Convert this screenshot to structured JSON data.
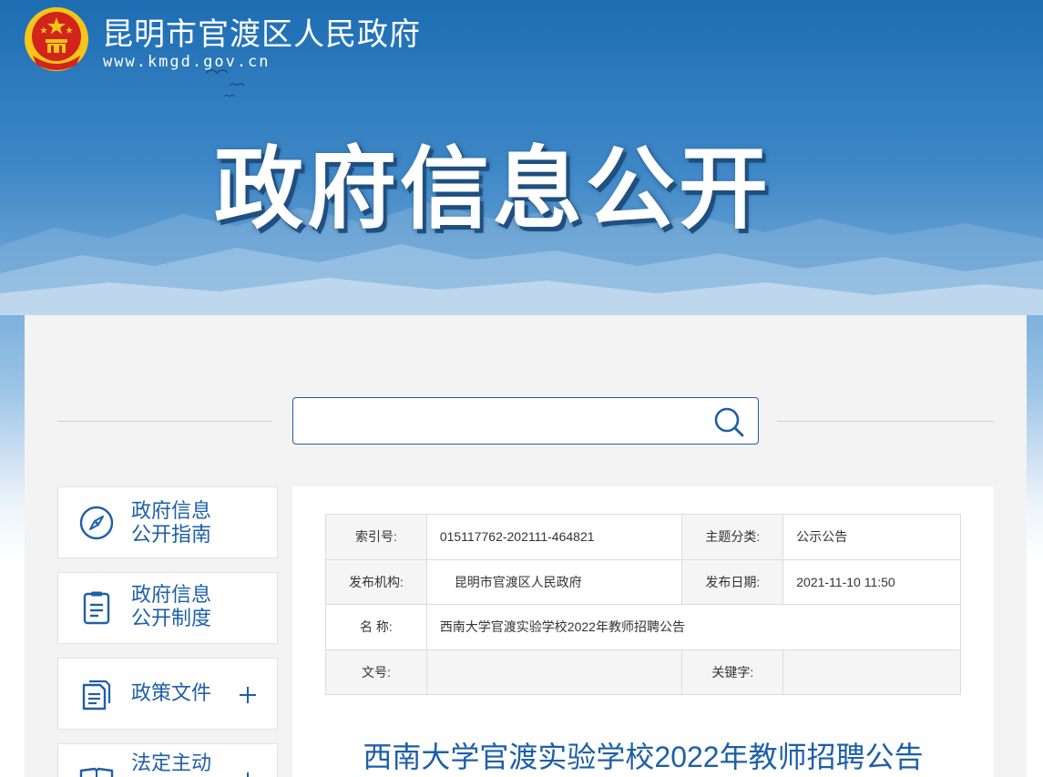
{
  "header": {
    "site_name": "昆明市官渡区人民政府",
    "site_url": "www.kmgd.gov.cn",
    "banner_title": "政府信息公开"
  },
  "search": {
    "value": "",
    "placeholder": ""
  },
  "sidebar": {
    "items": [
      {
        "line1": "政府信息",
        "line2": "公开指南",
        "icon": "compass-icon"
      },
      {
        "line1": "政府信息",
        "line2": "公开制度",
        "icon": "document-icon"
      },
      {
        "line1": "政策文件",
        "line2": "",
        "icon": "files-icon",
        "expandable": true
      },
      {
        "line1": "法定主动",
        "line2": "",
        "icon": "book-icon",
        "expandable": true
      }
    ]
  },
  "meta": {
    "index_label": "索引号:",
    "index_value": "015117762-202111-464821",
    "topic_label": "主题分类:",
    "topic_value": "公示公告",
    "publisher_label": "发布机构:",
    "publisher_value": "昆明市官渡区人民政府",
    "date_label": "发布日期:",
    "date_value": "2021-11-10 11:50",
    "name_label": "名 称:",
    "name_value": "西南大学官渡实验学校2022年教师招聘公告",
    "docno_label": "文号:",
    "docno_value": "",
    "keyword_label": "关键字:",
    "keyword_value": ""
  },
  "article": {
    "title": "西南大学官渡实验学校2022年教师招聘公告"
  },
  "colors": {
    "brand_blue": "#1e5fa8",
    "header_blue": "#1d6db3",
    "emblem_red": "#d2231c",
    "emblem_gold": "#f5c518"
  }
}
